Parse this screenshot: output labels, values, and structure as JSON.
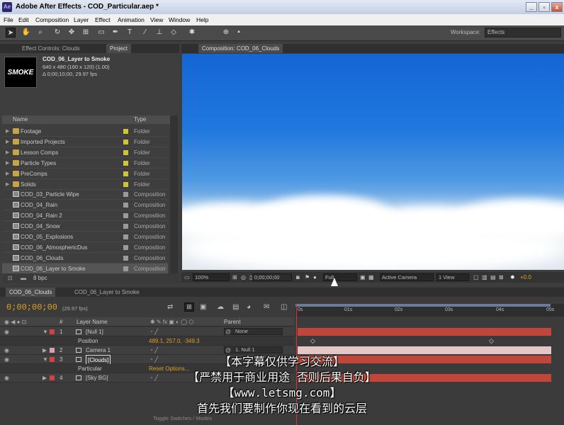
{
  "window": {
    "title": "Adobe After Effects - COD_Particular.aep *",
    "app_icon": "Ae",
    "buttons": [
      "_",
      "▫",
      "x"
    ]
  },
  "menu": [
    "File",
    "Edit",
    "Composition",
    "Layer",
    "Effect",
    "Animation",
    "View",
    "Window",
    "Help"
  ],
  "workspace": {
    "label": "Workspace:",
    "value": "Effects"
  },
  "left_tabs": [
    "Effect Controls: Clouds",
    "Project"
  ],
  "project": {
    "comp_name": "COD_06_Layer to Smoke",
    "dims": "640 x 480  (160 x 120) (1.00)",
    "duration": "Δ 0;00;10;00, 29.97 fps",
    "thumb_text": "SMOKE",
    "col_name": "Name",
    "col_type": "Type",
    "items": [
      {
        "name": "Footage",
        "type": "Folder",
        "kind": "folder"
      },
      {
        "name": "Imported Projects",
        "type": "Folder",
        "kind": "folder"
      },
      {
        "name": "Lesson Comps",
        "type": "Folder",
        "kind": "folder"
      },
      {
        "name": "Particle Types",
        "type": "Folder",
        "kind": "folder"
      },
      {
        "name": "PreComps",
        "type": "Folder",
        "kind": "folder"
      },
      {
        "name": "Solids",
        "type": "Folder",
        "kind": "folder"
      },
      {
        "name": "COD_03_Particle Wipe",
        "type": "Composition",
        "kind": "comp"
      },
      {
        "name": "COD_04_Rain",
        "type": "Composition",
        "kind": "comp"
      },
      {
        "name": "COD_04_Rain 2",
        "type": "Composition",
        "kind": "comp"
      },
      {
        "name": "COD_04_Snow",
        "type": "Composition",
        "kind": "comp"
      },
      {
        "name": "COD_05_Explosions",
        "type": "Composition",
        "kind": "comp"
      },
      {
        "name": "COD_06_AtmosphericDus",
        "type": "Composition",
        "kind": "comp"
      },
      {
        "name": "COD_06_Clouds",
        "type": "Composition",
        "kind": "comp"
      },
      {
        "name": "COD_06_Layer to Smoke",
        "type": "Composition",
        "kind": "comp"
      }
    ],
    "bpc": "8 bpc"
  },
  "comp_tab": "Composition: COD_06_Clouds",
  "comp_controls": {
    "zoom": "100%",
    "timecode": "0;00;00;00",
    "resolution": "Full",
    "camera": "Active Camera",
    "view": "1 View",
    "exposure": "+0.0"
  },
  "timeline": {
    "tabs": [
      "COD_06_Clouds",
      "COD_06_Layer to Smoke"
    ],
    "timecode": "0;00;00;00",
    "fps": "(29.97 fps)",
    "header": {
      "layer_name": "Layer Name",
      "parent": "Parent",
      "num": "#"
    },
    "layers": [
      {
        "num": "1",
        "name": "[Null 1]",
        "parent": "None",
        "color": "#c44",
        "bar": "#c0463a"
      },
      {
        "num": "",
        "name": "Position",
        "value": "489.1, 257.0, -349.3"
      },
      {
        "num": "2",
        "name": "Camera 1",
        "parent": "1. Null 1",
        "color": "#d9a0b0",
        "bar": "#e5c6c6"
      },
      {
        "num": "3",
        "name": "[Clouds]",
        "parent": "",
        "color": "#c44",
        "bar": "#c0463a"
      },
      {
        "num": "",
        "name": "Particular",
        "value": "Reset  Options..."
      },
      {
        "num": "4",
        "name": "[Sky BG]",
        "parent": "None",
        "color": "#c44",
        "bar": "#c0463a"
      }
    ],
    "ticks": [
      "0s",
      "01s",
      "02s",
      "03s",
      "04s",
      "05s"
    ],
    "footer": "Toggle Switches / Modes"
  },
  "subtitles": [
    "【本字幕仅供学习交流】",
    "【严禁用于商业用途 否则后果自负】",
    "【www.letsmg.com】",
    "首先我们要制作你现在看到的云层"
  ]
}
